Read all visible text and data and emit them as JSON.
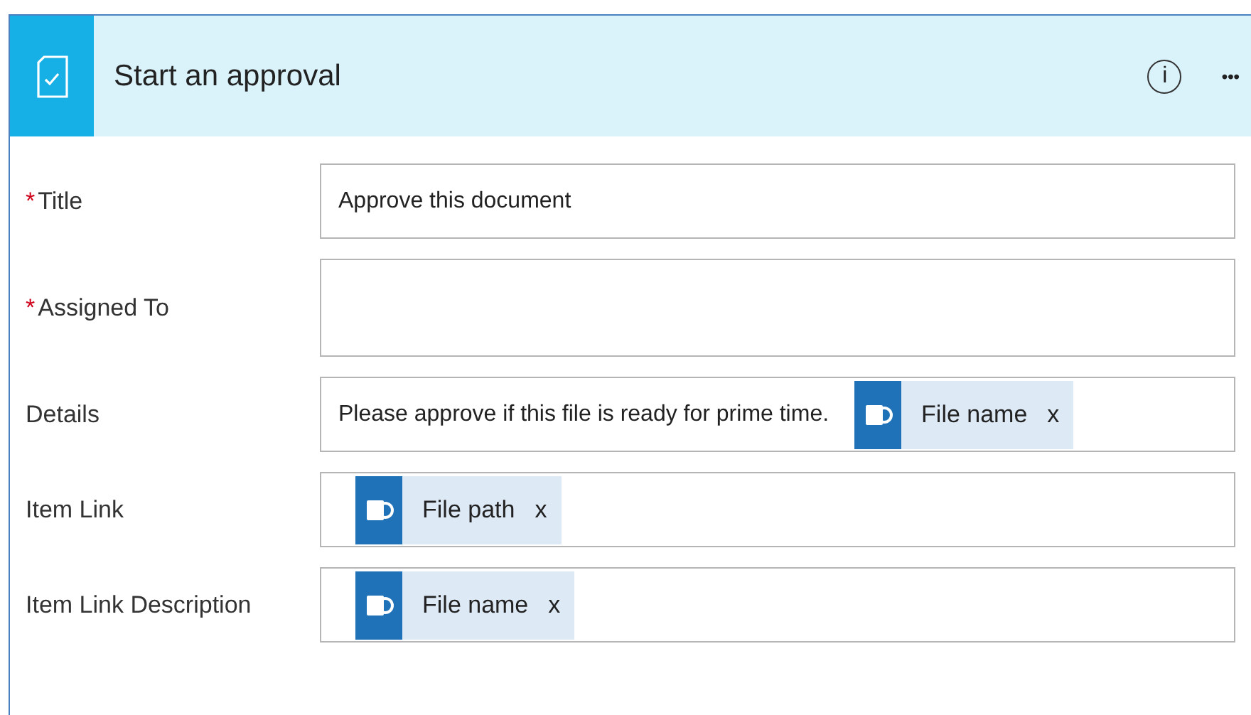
{
  "header": {
    "title": "Start an approval",
    "info_symbol": "i",
    "more": "•••"
  },
  "fields": [
    {
      "label": "Title",
      "required": true,
      "required_mark": "*",
      "text": "Approve this document"
    },
    {
      "label": "Assigned To",
      "required": true,
      "required_mark": "*"
    },
    {
      "label": "Details",
      "required": false,
      "text": "Please approve if this file is ready for prime time.",
      "tokens": [
        {
          "label": "File name",
          "remove": "x"
        }
      ]
    },
    {
      "label": "Item Link",
      "required": false,
      "tokens": [
        {
          "label": "File path",
          "remove": "x"
        }
      ]
    },
    {
      "label": "Item Link Description",
      "required": false,
      "tokens": [
        {
          "label": "File name",
          "remove": "x"
        }
      ]
    }
  ]
}
